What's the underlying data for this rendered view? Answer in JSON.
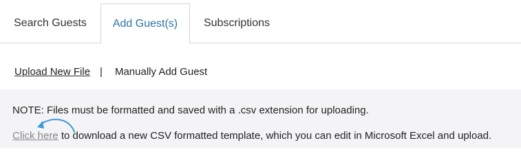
{
  "tabs": [
    {
      "label": "Search Guests"
    },
    {
      "label": "Add Guest(s)"
    },
    {
      "label": "Subscriptions"
    }
  ],
  "subnav": {
    "upload_label": "Upload New File",
    "separator": "|",
    "manual_label": "Manually Add Guest"
  },
  "panel": {
    "note": "NOTE: Files must be formatted and saved with a .csv extension for uploading.",
    "click_here": "Click here",
    "download_text": " to download a new CSV formatted template, which you can edit in Microsoft Excel and upload."
  },
  "colors": {
    "active_tab": "#2a73a8",
    "arrow": "#3b9ad9",
    "panel_bg": "#f4f4f6"
  },
  "icons": {
    "arrow": "curved-arrow-icon"
  }
}
